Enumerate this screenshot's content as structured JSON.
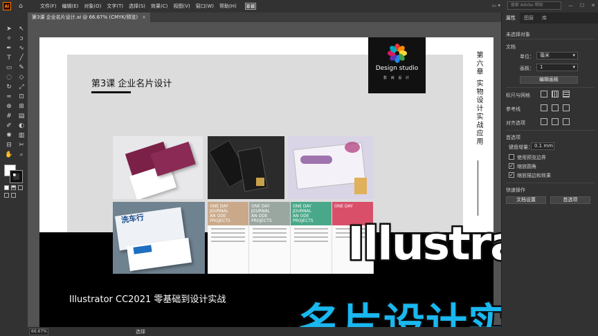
{
  "app": {
    "logo": "Ai"
  },
  "menu": {
    "items": [
      "文件(F)",
      "编辑(E)",
      "对象(O)",
      "文字(T)",
      "选择(S)",
      "效果(C)",
      "视图(V)",
      "窗口(W)",
      "帮助(H)"
    ],
    "search_placeholder": "搜索 Adobe 帮助"
  },
  "tab": {
    "title": "第3课 企业名片设计.ai @ 66.67% (CMYK/预览)",
    "close": "×"
  },
  "artboard": {
    "lesson_title": "第3课  企业名片设计",
    "logo_title": "Design studio",
    "logo_subtitle": "影 尚 设 计",
    "vertical_text": "第六章 实物设计实战应用",
    "course_name": "Illustrator CC2021 零基础到设计实战",
    "card_columns": [
      {
        "header": "ONE DAY\nJOURNAL\nAN ODE\nPROJECTS",
        "color": "#c9a98a"
      },
      {
        "header": "ONE DAY\nJOURNAL\nAN ODE\nPROJECTS",
        "color": "#9aa7a0"
      },
      {
        "header": "ONE DAY\nJOURNAL\nAN ODE\nPROJECTS",
        "color": "#4aa88a"
      },
      {
        "header": "ONE DAY",
        "color": "#d94f6a"
      }
    ]
  },
  "overlay": {
    "title_en": "Illustrator",
    "title_cn": "名片设计实例"
  },
  "right_panel": {
    "tabs": [
      "属性",
      "图层",
      "库"
    ],
    "no_selection": "未选择对象",
    "document_label": "文档",
    "unit_label": "单位：",
    "unit_value": "毫米",
    "artboard_label": "画板：",
    "artboard_value": "1",
    "edit_artboard_button": "编辑画板",
    "rulers_grids_label": "标尺与网格",
    "guides_label": "参考线",
    "snap_label": "对齐选项",
    "preferences_label": "首选项",
    "keyboard_increment_label": "键盘增量：",
    "keyboard_increment_value": "0.1 mm",
    "checkboxes": [
      {
        "label": "使用预览边界",
        "checked": false
      },
      {
        "label": "缩放圆角",
        "checked": true
      },
      {
        "label": "缩放描边和效果",
        "checked": true
      }
    ],
    "quick_actions_label": "快速操作",
    "doc_setup_button": "文档设置",
    "preferences_button": "首选项"
  },
  "status": {
    "zoom": "66.67%",
    "tool": "选择"
  }
}
